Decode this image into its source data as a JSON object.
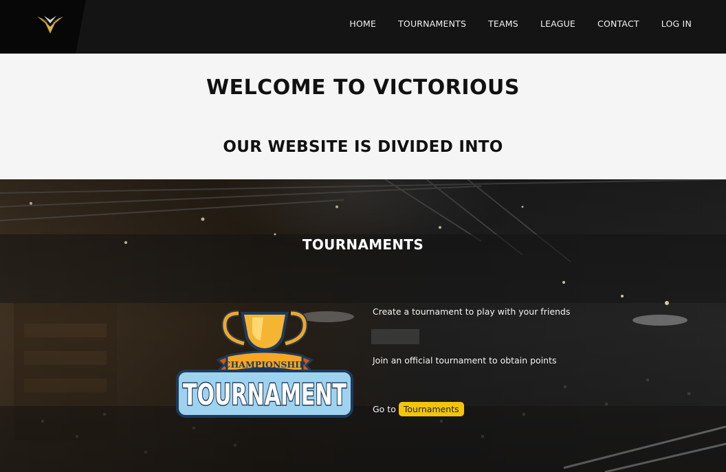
{
  "nav": {
    "logo_alt": "Victorious logo",
    "items": [
      {
        "label": "HOME"
      },
      {
        "label": "TOURNAMENTS"
      },
      {
        "label": "TEAMS"
      },
      {
        "label": "LEAGUE"
      },
      {
        "label": "CONTACT"
      },
      {
        "label": "LOG IN"
      }
    ]
  },
  "welcome": {
    "title": "WELCOME TO VICTORIOUS",
    "subtitle": "OUR WEBSITE IS DIVIDED INTO"
  },
  "tournaments": {
    "title": "TOURNAMENTS",
    "badge_top": "CHAMPIONSHIP",
    "badge_main": "TOURNAMENT",
    "feature_1": "Create a tournament to play with your friends",
    "feature_2": "Join an official tournament to obtain points",
    "goto_prefix": "Go to",
    "goto_button": "Tournaments"
  },
  "colors": {
    "accent": "#f4c40d",
    "navbar": "#141414",
    "light_bg": "#f5f5f5"
  }
}
